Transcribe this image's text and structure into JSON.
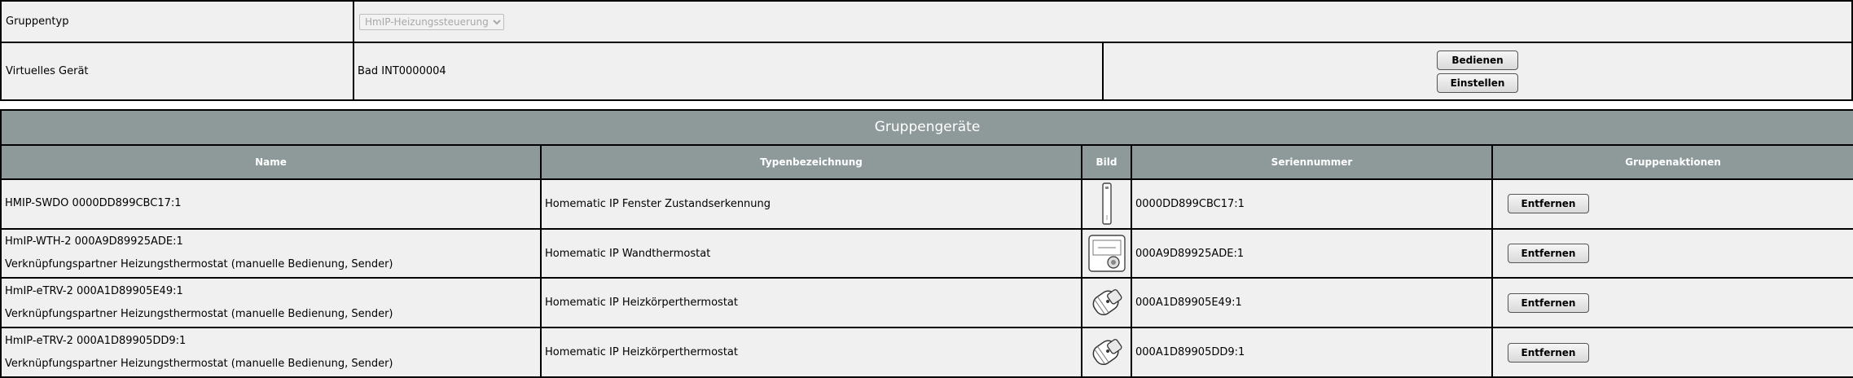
{
  "settings": {
    "group_type_label": "Gruppentyp",
    "group_type_value": "HmIP-Heizungssteuerung",
    "virtual_device_label": "Virtuelles Gerät",
    "virtual_device_value": "Bad INT0000004",
    "operate_button": "Bedienen",
    "configure_button": "Einstellen"
  },
  "group_devices": {
    "caption": "Gruppengeräte",
    "columns": [
      "Name",
      "Typenbezeichnung",
      "Bild",
      "Seriennummer",
      "Gruppenaktionen"
    ],
    "rows": [
      {
        "name": "HMIP-SWDO 0000DD899CBC17:1",
        "role": "",
        "type": "Homematic IP Fenster Zustandserkennung",
        "image_icon": "window-contact-sensor-icon",
        "serial": "0000DD899CBC17:1",
        "action": "Entfernen"
      },
      {
        "name": "HmIP-WTH-2 000A9D89925ADE:1",
        "role": "Verknüpfungspartner Heizungsthermostat (manuelle Bedienung, Sender)",
        "type": "Homematic IP Wandthermostat",
        "image_icon": "wall-thermostat-icon",
        "serial": "000A9D89925ADE:1",
        "action": "Entfernen"
      },
      {
        "name": "HmIP-eTRV-2 000A1D89905E49:1",
        "role": "Verknüpfungspartner Heizungsthermostat (manuelle Bedienung, Sender)",
        "type": "Homematic IP Heizkörperthermostat",
        "image_icon": "radiator-thermostat-icon",
        "serial": "000A1D89905E49:1",
        "action": "Entfernen"
      },
      {
        "name": "HmIP-eTRV-2 000A1D89905DD9:1",
        "role": "Verknüpfungspartner Heizungsthermostat (manuelle Bedienung, Sender)",
        "type": "Homematic IP Heizkörperthermostat",
        "image_icon": "radiator-thermostat-icon",
        "serial": "000A1D89905DD9:1",
        "action": "Entfernen"
      }
    ]
  }
}
